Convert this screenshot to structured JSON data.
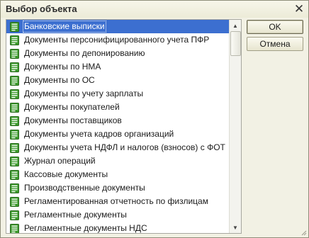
{
  "window": {
    "title": "Выбор объекта",
    "close_glyph": "✕"
  },
  "list": {
    "selected_index": 0,
    "items": [
      {
        "label": "Банковские выписки",
        "icon": "document-icon"
      },
      {
        "label": "Документы персонифицированного учета ПФР",
        "icon": "document-icon"
      },
      {
        "label": "Документы по депонированию",
        "icon": "document-icon"
      },
      {
        "label": "Документы по НМА",
        "icon": "document-icon"
      },
      {
        "label": "Документы по ОС",
        "icon": "document-icon"
      },
      {
        "label": "Документы по учету зарплаты",
        "icon": "document-icon"
      },
      {
        "label": "Документы покупателей",
        "icon": "document-icon"
      },
      {
        "label": "Документы поставщиков",
        "icon": "document-icon"
      },
      {
        "label": "Документы учета кадров организаций",
        "icon": "document-icon"
      },
      {
        "label": "Документы учета НДФЛ и налогов (взносов) с ФОТ",
        "icon": "document-icon"
      },
      {
        "label": "Журнал операций",
        "icon": "document-icon"
      },
      {
        "label": "Кассовые документы",
        "icon": "document-icon"
      },
      {
        "label": "Производственные документы",
        "icon": "document-icon"
      },
      {
        "label": "Регламентированная отчетность по физлицам",
        "icon": "document-icon"
      },
      {
        "label": "Регламентные документы",
        "icon": "document-icon"
      },
      {
        "label": "Регламентные документы НДС",
        "icon": "document-icon"
      }
    ]
  },
  "buttons": {
    "ok": "OK",
    "cancel": "Отмена"
  },
  "colors": {
    "selection": "#3c6fd0",
    "icon_green": "#3a9a2a",
    "dialog_bg": "#f2f1e4"
  }
}
